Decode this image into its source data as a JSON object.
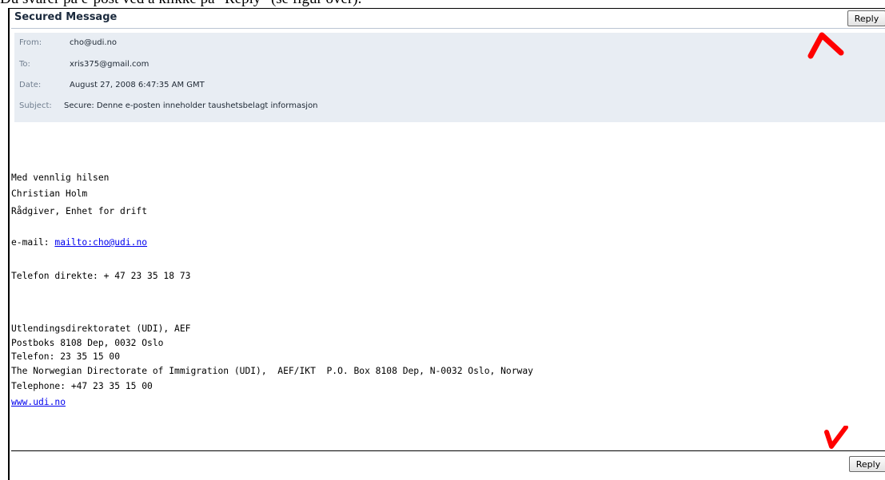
{
  "caption": "Du svarer på e-post ved å klikke på \"Reply\" (se figur over).",
  "window": {
    "title": "Secured Message",
    "reply_label": "Reply"
  },
  "header": {
    "from": {
      "label": "From:",
      "value": "cho@udi.no"
    },
    "to": {
      "label": "To:",
      "value": "xris375@gmail.com"
    },
    "date": {
      "label": "Date:",
      "value": "August 27, 2008 6:47:35 AM GMT"
    },
    "subject": {
      "label": "Subject:",
      "value": "Secure: Denne e-posten inneholder taushetsbelagt informasjon"
    }
  },
  "body": {
    "greeting": "Med vennlig hilsen",
    "name": "Christian Holm",
    "role": "Rådgiver, Enhet for drift",
    "email_prefix": "e-mail: ",
    "email_link": "mailto:cho@udi.no",
    "phone_direct": "Telefon direkte: + 47 23 35 18 73",
    "org_line1": "Utlendingsdirektoratet (UDI), AEF",
    "org_line2": "Postboks 8108 Dep, 0032 Oslo",
    "org_line3": "Telefon: 23 35 15 00",
    "org_line4": "The Norwegian Directorate of Immigration (UDI),  AEF/IKT  P.O. Box 8108 Dep, N-0032 Oslo, Norway",
    "org_line5": "Telephone: +47 23 35 15 00",
    "website": "www.udi.no"
  },
  "annotations": {
    "arrow_color": "#ff0000",
    "arrow_top_icon": "red-arrow-up-right-icon",
    "arrow_bottom_icon": "red-arrow-down-right-icon"
  }
}
